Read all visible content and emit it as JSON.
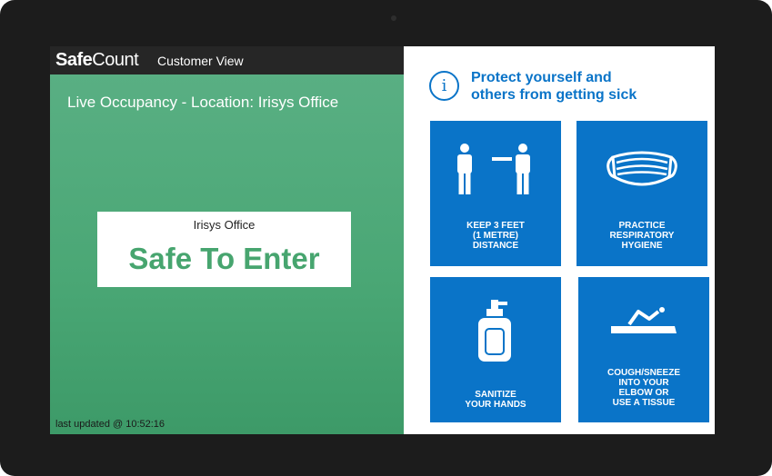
{
  "header": {
    "logo_safe": "Safe",
    "logo_count": "Count",
    "view_label": "Customer View"
  },
  "occupancy": {
    "title": "Live Occupancy - Location: Irisys Office",
    "location_name": "Irisys Office",
    "status": "Safe To Enter",
    "last_updated": "last updated @ 10:52:16"
  },
  "advice": {
    "info_glyph": "i",
    "heading_line1": "Protect yourself and",
    "heading_line2": "others from getting sick",
    "tiles": [
      {
        "icon": "social-distance-icon",
        "caption": "KEEP 3 FEET\n(1 METRE)\nDISTANCE"
      },
      {
        "icon": "face-mask-icon",
        "caption": "PRACTICE\nRESPIRATORY\nHYGIENE"
      },
      {
        "icon": "hand-sanitizer-icon",
        "caption": "SANITIZE\nYOUR HANDS"
      },
      {
        "icon": "elbow-cough-icon",
        "caption": "COUGH/SNEEZE\nINTO YOUR\nELBOW OR\nUSE A TISSUE"
      }
    ]
  },
  "colors": {
    "status_green": "#47a56f",
    "panel_green": "#4aa775",
    "advice_blue": "#0a74c8",
    "top_bar": "#262626"
  }
}
